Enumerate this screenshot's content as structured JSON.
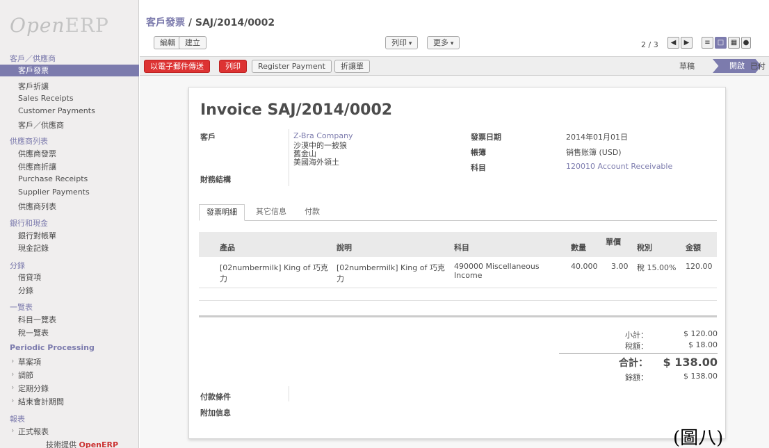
{
  "logo": {
    "open": "Open",
    "erp": "ERP"
  },
  "sidebar": {
    "sections": [
      {
        "label": "客戶／供應商",
        "items": [
          {
            "label": "客戶發票",
            "active": true
          },
          {
            "label": "客戶折讓"
          },
          {
            "label": "Sales Receipts"
          },
          {
            "label": "Customer Payments"
          },
          {
            "label": "客戶／供應商"
          }
        ]
      },
      {
        "label": "供應商列表",
        "items": [
          {
            "label": "供應商發票"
          },
          {
            "label": "供應商折讓"
          },
          {
            "label": "Purchase Receipts"
          },
          {
            "label": "Supplier Payments"
          },
          {
            "label": "供應商列表"
          }
        ]
      },
      {
        "label": "銀行和現金",
        "items": [
          {
            "label": "銀行對帳單"
          },
          {
            "label": "現金記錄"
          }
        ]
      },
      {
        "label": "分錄",
        "items": [
          {
            "label": "借貸項"
          },
          {
            "label": "分錄"
          }
        ]
      },
      {
        "label": "一覽表",
        "items": [
          {
            "label": "科目一覽表"
          },
          {
            "label": "稅一覽表"
          }
        ]
      },
      {
        "label": "Periodic Processing",
        "items": [
          {
            "label": "草案項",
            "folder": true
          },
          {
            "label": "調節",
            "folder": true
          },
          {
            "label": "定期分錄",
            "folder": true
          },
          {
            "label": "結束會計期間",
            "folder": true
          }
        ]
      },
      {
        "label": "報表",
        "items": [
          {
            "label": "正式報表",
            "folder": true
          }
        ]
      }
    ],
    "powered_prefix": "技術提供",
    "powered_brand": "OpenERP"
  },
  "header": {
    "breadcrumb_parent": "客戶發票",
    "breadcrumb_sep": " / ",
    "breadcrumb_current": "SAJ/2014/0002",
    "edit": "編輯",
    "create": "建立",
    "print_menu": "列印",
    "more_menu": "更多",
    "pager": "2 / 3"
  },
  "statusbar": {
    "send_email": "以電子郵件傳送",
    "print": "列印",
    "register_payment": "Register Payment",
    "refund": "折讓單",
    "stage_draft": "草稿",
    "stage_open": "開啟",
    "stage_paid": "已付"
  },
  "invoice": {
    "title": "Invoice SAJ/2014/0002",
    "customer_label": "客戶",
    "customer_name": "Z-Bra Company",
    "address_1": "沙漠中的一披狼",
    "address_2": "舊金山",
    "address_3": "美國海外領土",
    "fiscal_label": "財務結構",
    "date_label": "發票日期",
    "date_value": "2014年01月01日",
    "journal_label": "帳簿",
    "journal_value": "销售账簿 (USD)",
    "account_label": "科目",
    "account_value": "120010 Account Receivable",
    "tabs": [
      "發票明細",
      "其它信息",
      "付款"
    ],
    "columns": {
      "product": "產品",
      "description": "說明",
      "account": "科目",
      "qty": "數量",
      "price": "單價",
      "tax": "稅別",
      "amount": "金額"
    },
    "line": {
      "product_1": "[02numbermilk] King of 巧克",
      "product_2": "力",
      "desc_1": "[02numbermilk] King of 巧克",
      "desc_2": "力",
      "account_1": "490000 Miscellaneous",
      "account_2": "Income",
      "qty": "40.000",
      "price": "3.00",
      "tax": "稅 15.00%",
      "amount": "120.00"
    },
    "subtotal_label": "小計：",
    "subtotal": "$ 120.00",
    "tax_label": "稅額：",
    "tax": "$ 18.00",
    "total_label": "合計：",
    "total": "$ 138.00",
    "balance_label": "餘額：",
    "balance": "$ 138.00",
    "payment_terms_label": "付款條件",
    "comment_label": "附加信息"
  },
  "caption": "(圖八)"
}
